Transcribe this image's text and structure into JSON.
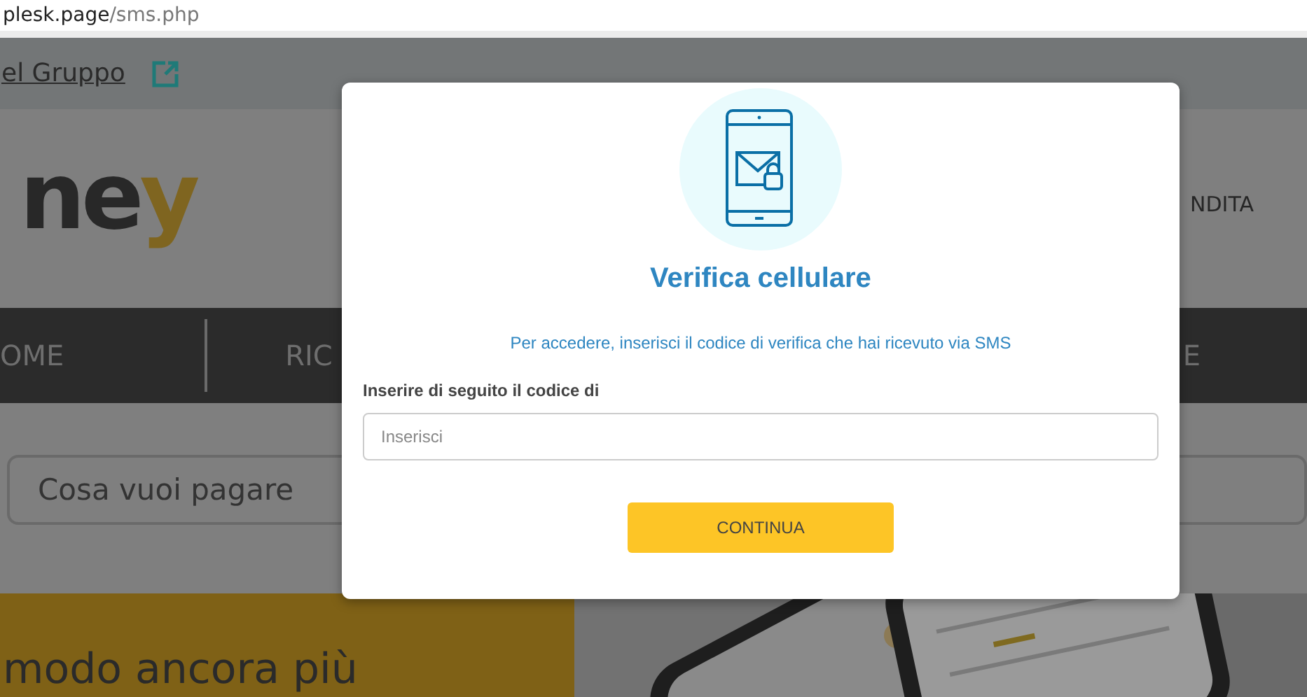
{
  "browser": {
    "url_host": "plesk.page",
    "url_path": "/sms.php"
  },
  "site": {
    "top_link": "el Gruppo",
    "logo": {
      "text": "ne",
      "accent": "y"
    },
    "header_link": "NDITA",
    "nav": [
      "OME",
      "RIC",
      "E"
    ],
    "search": {
      "placeholder": "Cosa vuoi pagare"
    },
    "banner_heading": "modo ancora più"
  },
  "modal": {
    "title": "Verifica cellulare",
    "message": "Per accedere, inserisci il codice di verifica che hai ricevuto via SMS",
    "field": {
      "label": "Inserire di seguito il codice di",
      "placeholder": "Inserisci"
    },
    "button": "CONTINUA"
  }
}
